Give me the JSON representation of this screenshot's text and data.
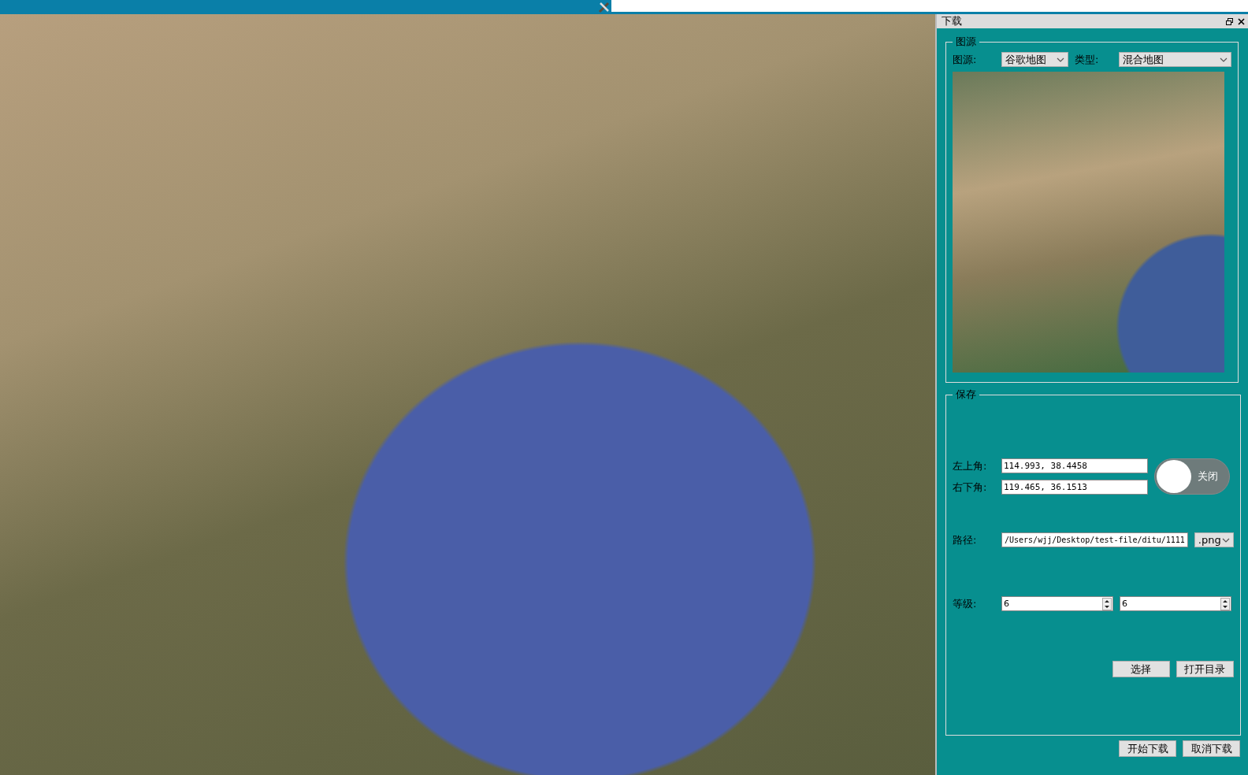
{
  "panel": {
    "title": "下载",
    "source_group": {
      "title": "图源",
      "source_label": "图源:",
      "source": "谷歌地图",
      "type_label": "类型:",
      "type": "混合地图"
    },
    "save_group": {
      "title": "保存",
      "top_left_label": "左上角:",
      "top_left": "114.993, 38.4458",
      "bottom_right_label": "右下角:",
      "bottom_right": "119.465, 36.1513",
      "switch": {
        "label": "关闭",
        "on": false
      },
      "path_label": "路径:",
      "path": "/Users/wjj/Desktop/test-file/ditu/1111",
      "format": ".png",
      "level_label": "等级:",
      "level_min": "6",
      "level_max": "6",
      "buttons": [
        "选择",
        "打开目录"
      ]
    },
    "buttons": [
      "开始下载",
      "取消下载"
    ]
  }
}
